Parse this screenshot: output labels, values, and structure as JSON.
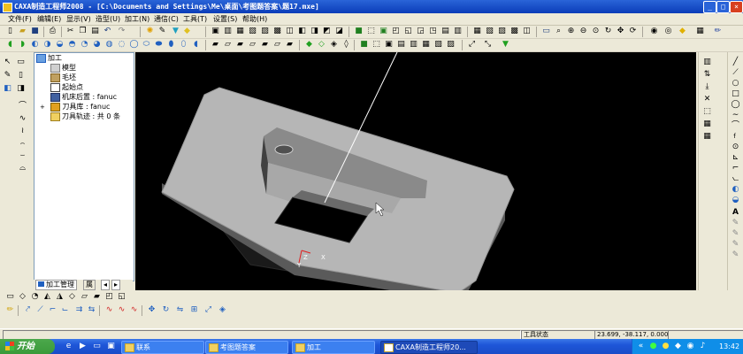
{
  "window": {
    "title": "CAXA制造工程师2008  - [C:\\Documents and Settings\\Me\\桌面\\考图题答案\\题17.mxe]",
    "minimize_icon": "minimize-icon",
    "maximize_icon": "maximize-icon",
    "close_icon": "close-icon"
  },
  "menu": {
    "items": [
      "文件(F)",
      "编辑(E)",
      "显示(V)",
      "造型(U)",
      "加工(N)",
      "通信(C)",
      "工具(T)",
      "设置(S)",
      "帮助(H)"
    ]
  },
  "tree": {
    "root": "加工",
    "items": [
      {
        "label": "模型",
        "icon": "model-icon"
      },
      {
        "label": "毛坯",
        "icon": "blank-stock-icon"
      },
      {
        "label": "起始点",
        "icon": "start-point-icon"
      },
      {
        "label": "机床后置 : fanuc",
        "icon": "machine-post-icon"
      },
      {
        "label": "刀具库 : fanuc",
        "icon": "tool-library-icon"
      },
      {
        "label": "刀具轨迹 : 共 0 条",
        "icon": "toolpath-folder-icon"
      }
    ],
    "tabs": [
      "加工管理",
      "属"
    ]
  },
  "viewport": {
    "axis_labels": {
      "z": "Z",
      "x": "X",
      "y": "Y"
    }
  },
  "status": {
    "tool_status": "工具状态",
    "coordinates": "23.699, -38.117, 0.000"
  },
  "taskbar": {
    "start_label": "开始",
    "buttons": [
      {
        "label": "联系",
        "active": false
      },
      {
        "label": "考图题答案",
        "active": false
      },
      {
        "label": "加工",
        "active": false
      },
      {
        "label": "CAXA制造工程师20...",
        "active": true
      }
    ],
    "clock": "13:42"
  },
  "colors": {
    "titlebar": "#0a3cb8",
    "viewport_bg": "#000000",
    "part_face": "#b4b4b4",
    "part_side": "#7a7a7a"
  }
}
